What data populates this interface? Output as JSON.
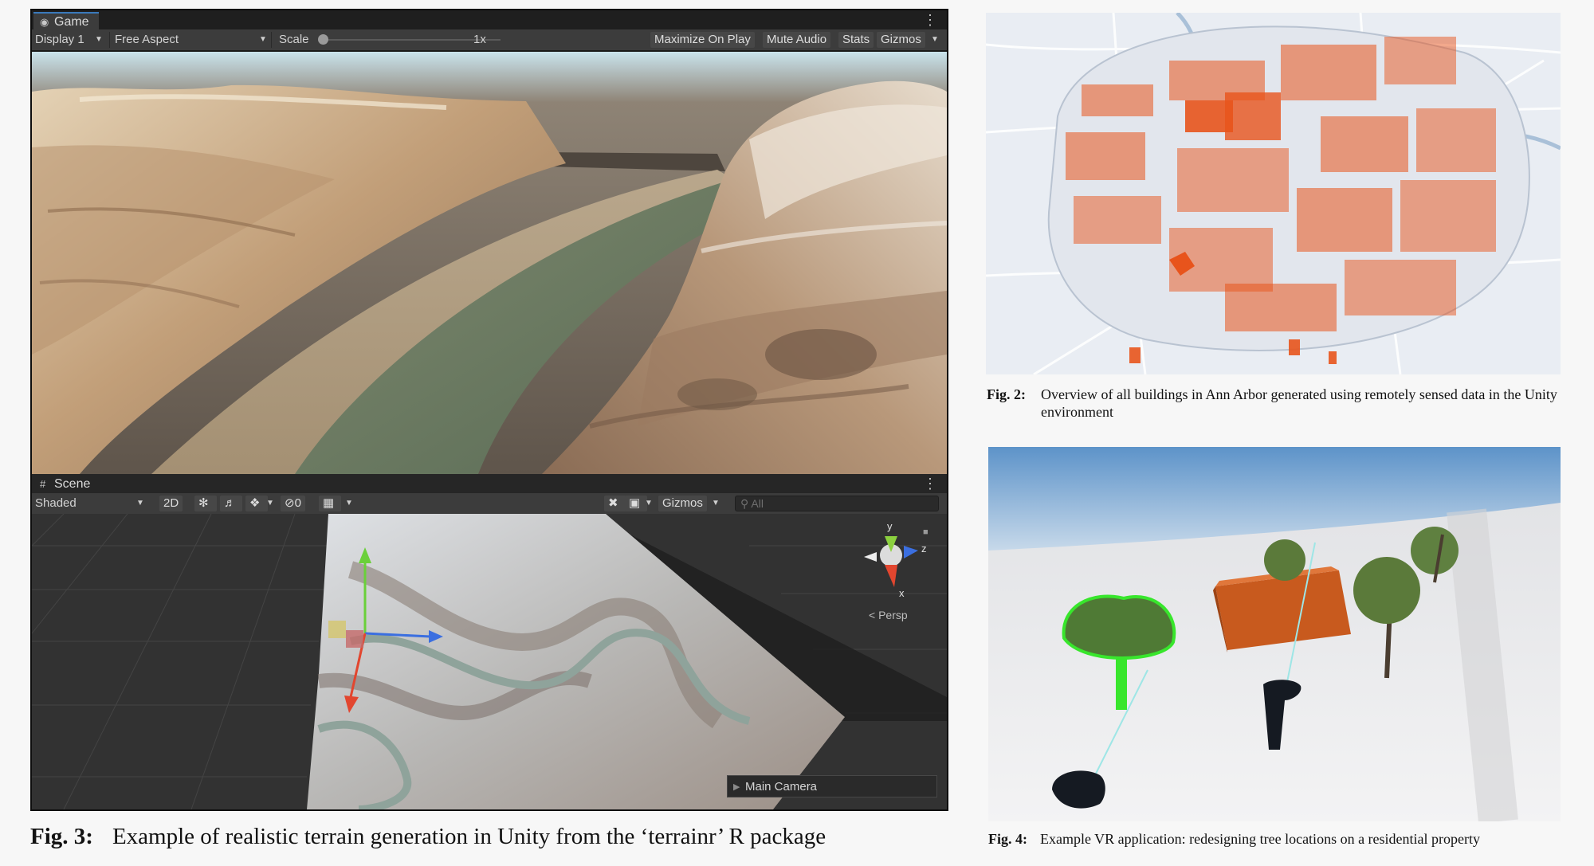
{
  "game_panel": {
    "tab_label": "Game",
    "display_dropdown": "Display 1",
    "aspect_dropdown": "Free Aspect",
    "scale_label": "Scale",
    "scale_value": "1x",
    "maximize_on_play": "Maximize On Play",
    "mute_audio": "Mute Audio",
    "stats": "Stats",
    "gizmos": "Gizmos"
  },
  "scene_panel": {
    "tab_label": "Scene",
    "shading_dropdown": "Shaded",
    "mode_2d": "2D",
    "hidden_count": "0",
    "gizmos": "Gizmos",
    "search_placeholder": "All",
    "camera_label": "Main Camera",
    "orientation_gizmo": {
      "y": "y",
      "z": "z",
      "x": "x",
      "persp": "Persp"
    }
  },
  "figures": {
    "fig3": {
      "number": "Fig. 3:",
      "text": "Example of realistic terrain generation in Unity from the ‘terrainr’ R package"
    },
    "fig2": {
      "number": "Fig. 2:",
      "text": "Overview of all buildings in Ann Arbor generated using remotely sensed data in the Unity environment"
    },
    "fig4": {
      "number": "Fig. 4:",
      "text": "Example VR application: redesigning tree locations on a residential property"
    }
  },
  "colors": {
    "unity_tab_accent": "#3a79bb",
    "building_orange": "#e8541c",
    "map_background": "#e9edf3",
    "selection_green": "#38e62c"
  }
}
